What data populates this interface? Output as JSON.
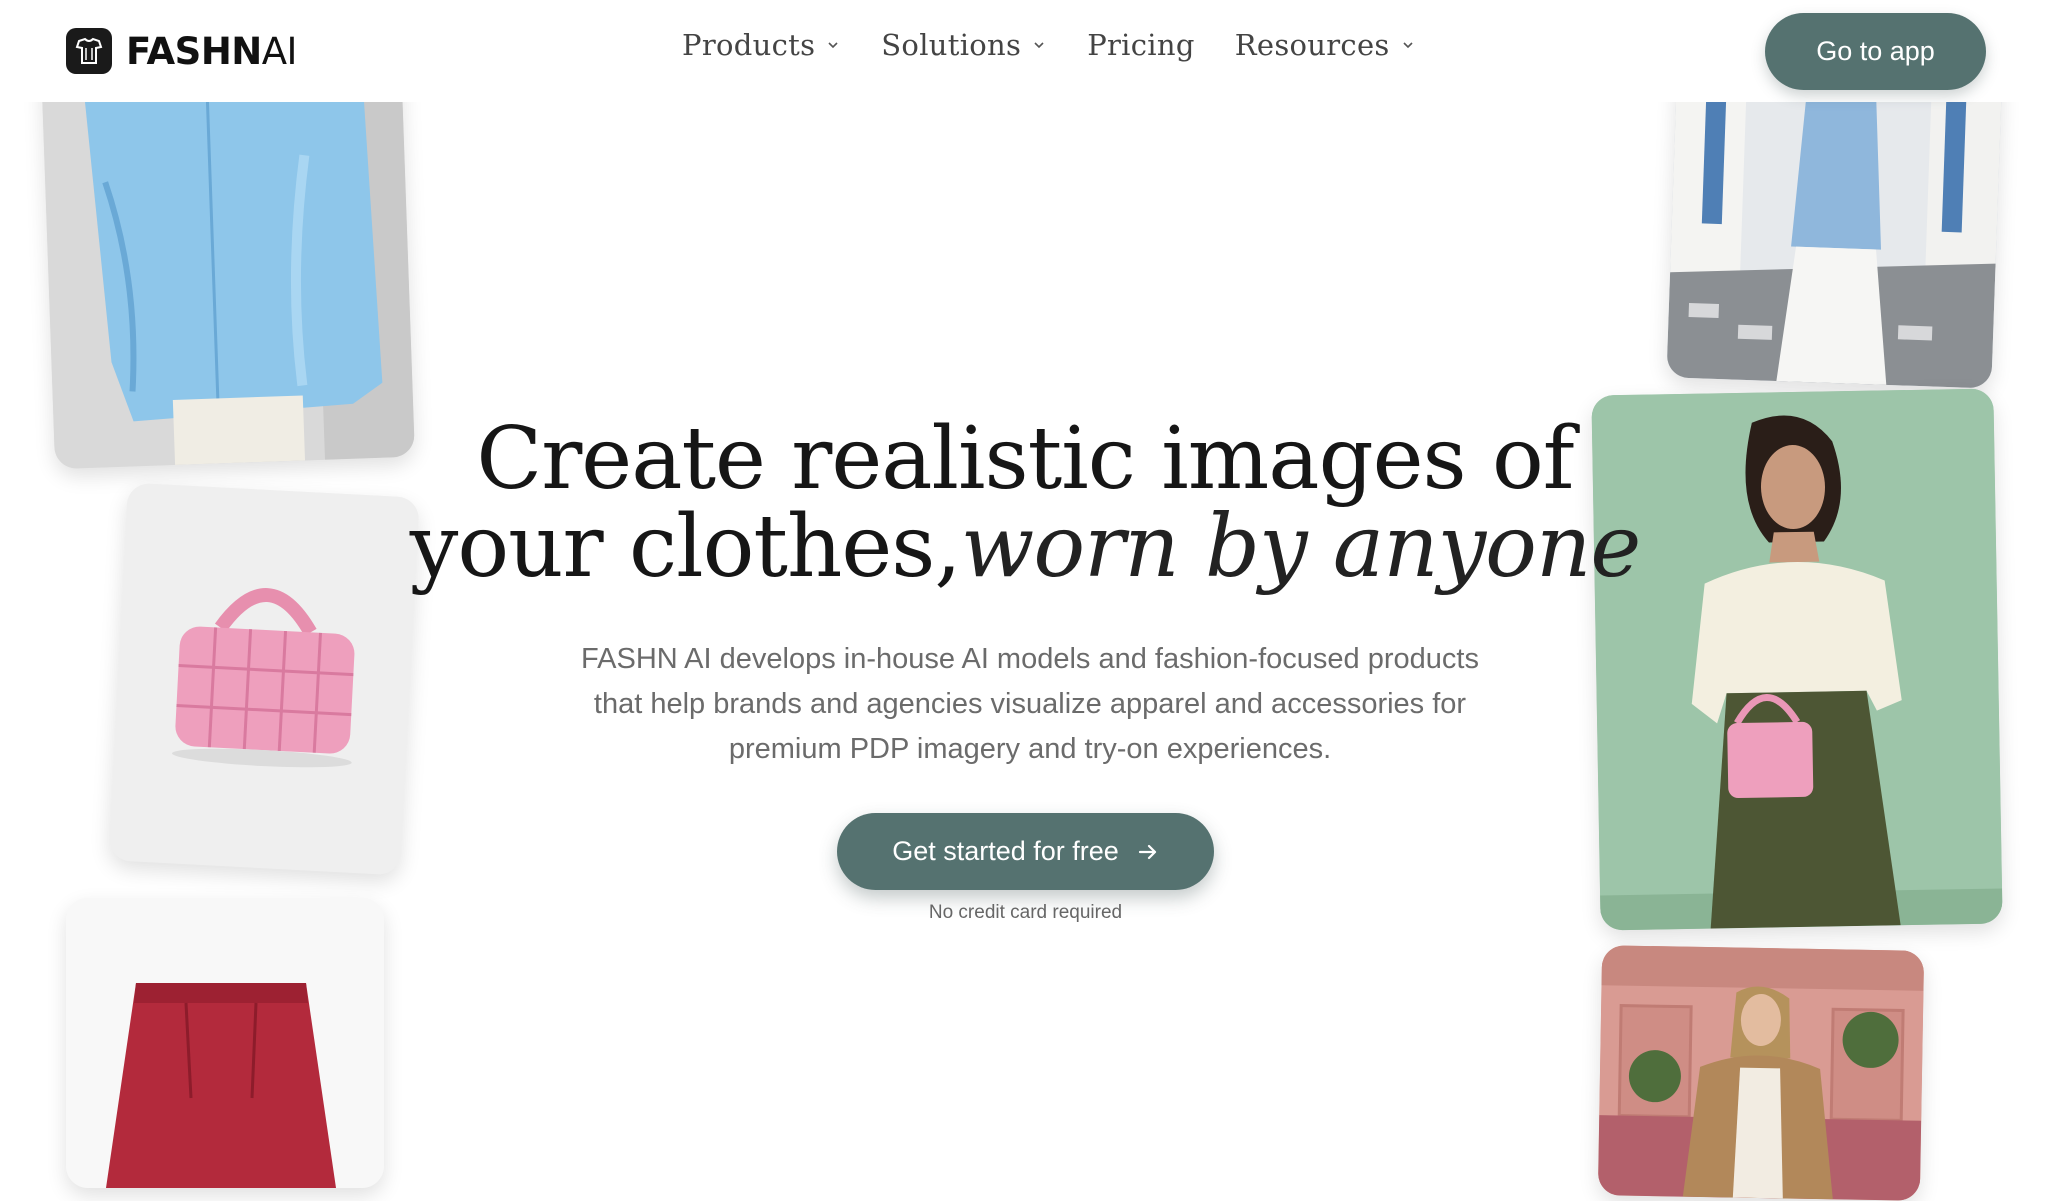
{
  "brand": {
    "name_bold": "FASHN",
    "name_light": "AI"
  },
  "nav": {
    "items": [
      {
        "label": "Products",
        "has_dropdown": true
      },
      {
        "label": "Solutions",
        "has_dropdown": true
      },
      {
        "label": "Pricing",
        "has_dropdown": false
      },
      {
        "label": "Resources",
        "has_dropdown": true
      }
    ],
    "app_button": "Go to app"
  },
  "hero": {
    "title_line1": "Create realistic images of",
    "title_line2_plain": "your clothes,",
    "title_line2_italic": "worn by anyone",
    "subtitle": "FASHN AI develops in-house AI models and fashion-focused products that help brands and agencies visualize apparel and accessories for premium PDP imagery and try-on experiences.",
    "cta": "Get started for free",
    "cta_icon": "arrow-right-icon",
    "note": "No credit card required"
  },
  "gallery": {
    "left": [
      "blue-satin-shirt-image",
      "pink-woven-handbag-image",
      "red-leather-skirt-image"
    ],
    "right": [
      "model-blue-shirt-street-image",
      "model-cream-blouse-green-backdrop-image",
      "model-camel-coat-cafe-image"
    ]
  },
  "colors": {
    "accent": "#557270",
    "text": "#161616",
    "muted": "#6b6b6b",
    "background": "#ffffff"
  }
}
